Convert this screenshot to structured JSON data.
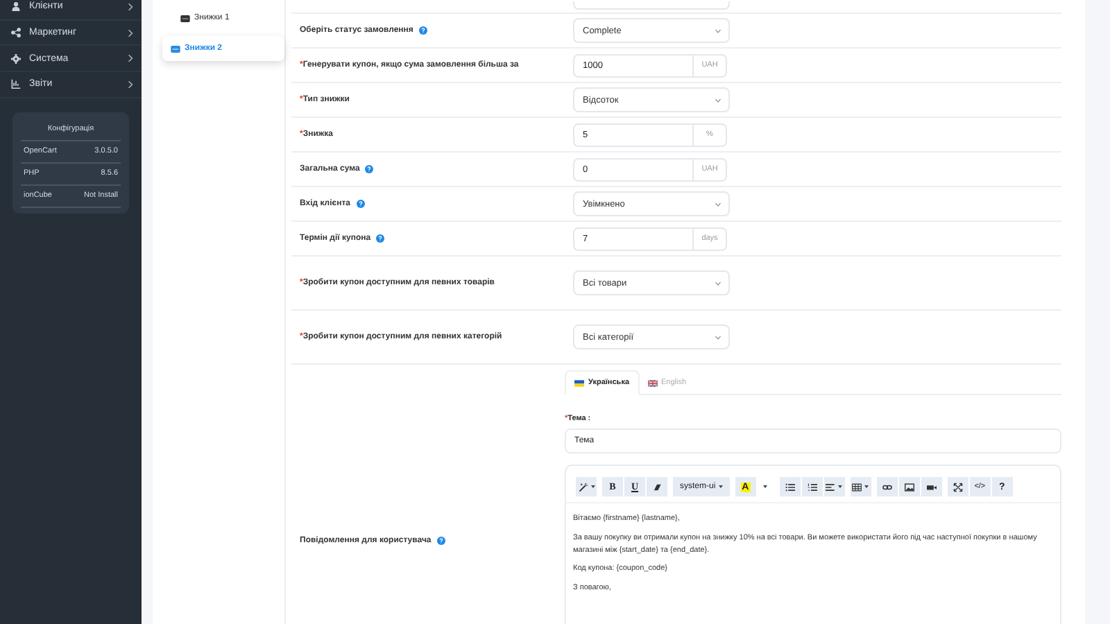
{
  "sidebar": {
    "items": [
      {
        "label": "Клієнти"
      },
      {
        "label": "Маркетинг"
      },
      {
        "label": "Система"
      },
      {
        "label": "Звіти"
      }
    ],
    "config": {
      "title": "Конфігурація",
      "rows": [
        {
          "name": "OpenCart",
          "value": "3.0.5.0"
        },
        {
          "name": "PHP",
          "value": "8.5.6"
        },
        {
          "name": "ionCube",
          "value": "Not Install"
        }
      ]
    }
  },
  "tabs": [
    {
      "label": "Знижки 1",
      "selected": false
    },
    {
      "label": "Знижки 2",
      "selected": true
    }
  ],
  "form": {
    "rows": [
      {
        "label": "Оберіть статус замовлення",
        "help": true,
        "kind": "select",
        "value": "Complete"
      },
      {
        "mark": "*",
        "label": "Генерувати купон, якщо сума замовлення більша за",
        "help": false,
        "kind": "input",
        "value": "1000",
        "addon": "UAH"
      },
      {
        "mark": "*",
        "label": "Тип знижки",
        "help": false,
        "kind": "select",
        "value": "Відсоток"
      },
      {
        "mark": "*",
        "label": "Знижка",
        "help": false,
        "kind": "input",
        "value": "5",
        "addon": "%"
      },
      {
        "label": "Загальна сума",
        "help": true,
        "kind": "input",
        "value": "0",
        "addon": "UAH"
      },
      {
        "label": "Вхід клієнта",
        "help": true,
        "kind": "select",
        "value": "Увімкнено"
      },
      {
        "label": "Термін дії купона",
        "help": true,
        "kind": "input",
        "value": "7",
        "addon": "days"
      },
      {
        "mark": "*",
        "label": "Зробити купон доступним для певних товарів",
        "help": false,
        "kind": "scope",
        "value": "Всі товари"
      },
      {
        "mark": "*",
        "label": "Зробити купон доступним для певних категорій",
        "help": false,
        "kind": "scope",
        "value": "Всі категорії"
      }
    ],
    "message": {
      "label": "Повідомлення для користувача",
      "help": true,
      "languages": [
        {
          "label": "Українська",
          "selected": true
        },
        {
          "label": "English",
          "selected": false
        }
      ],
      "subject_mark": "*",
      "subject_label": "Тема :",
      "subject_value": "Тема",
      "toolbar": {
        "bold": "B",
        "underline": "U",
        "font": "system-ui",
        "highlight": "A",
        "code": "</>",
        "help": "?"
      },
      "paragraphs": [
        "Вітаємо {firstname} {lastname},",
        "За вашу покупку ви отримали купон на знижку 10% на всі товари. Ви можете використати його під час наступної покупки в нашому магазині між {start_date} та {end_date}.",
        "Код купона: {coupon_code}",
        "З повагою,"
      ]
    }
  }
}
